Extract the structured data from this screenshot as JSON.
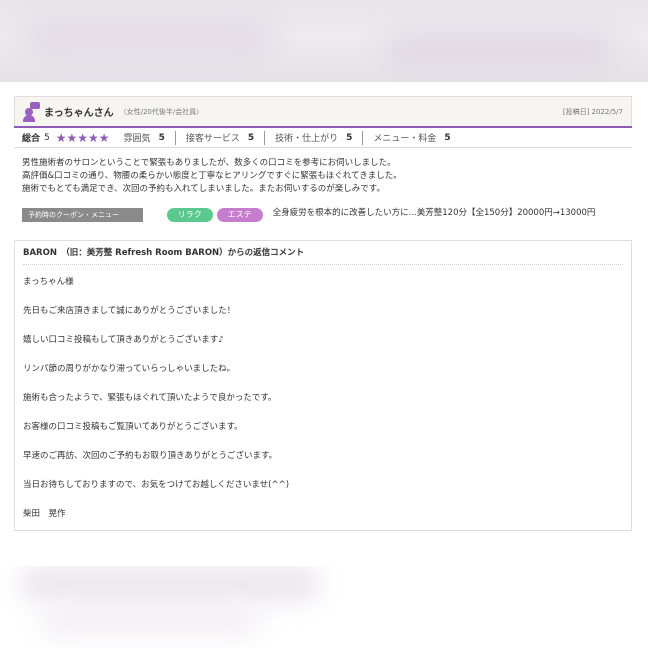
{
  "review": {
    "reviewer_name": "まっちゃんさん",
    "reviewer_attr": "（女性/20代後半/会社員）",
    "posted_date": "[投稿日] 2022/5/7",
    "overall_label": "総合",
    "overall_value": "5",
    "stars": "★★★★★",
    "star_color": "#8e5bb5",
    "sub_ratings": [
      {
        "label": "雰囲気",
        "value": "5"
      },
      {
        "label": "接客サービス",
        "value": "5"
      },
      {
        "label": "技術・仕上がり",
        "value": "5"
      },
      {
        "label": "メニュー・料金",
        "value": "5"
      }
    ],
    "body_lines": [
      "男性施術者のサロンということで緊張もありましたが、数多くの口コミを参考にお伺いしました。",
      "高評価&口コミの通り、物腰の柔らかい態度と丁寧なヒアリングですぐに緊張もほぐれてきました。",
      "施術でもとても満足でき、次回の予約も入れてしまいました。またお伺いするのが楽しみです。"
    ],
    "coupon_label": "予約時のクーポン・メニュー",
    "tags": [
      "リラク",
      "エステ"
    ],
    "tag_colors": {
      "relax": "#5bc98d",
      "esthe": "#c77dce"
    },
    "coupon_text": "全身疲労を根本的に改善したい方に...美芳整120分【全150分】20000円→13000円"
  },
  "reply": {
    "title": "BARON　（旧：美芳整 Refresh Room BARON）からの返信コメント",
    "lines": [
      "まっちゃん様",
      "先日もご来店頂きまして誠にありがとうございました！",
      "嬉しい口コミ投稿もして頂きありがとうございます♪",
      "リンパ節の周りがかなり滞っていらっしゃいましたね。",
      "施術も合ったようで、緊張もほぐれて頂いたようで良かったです。",
      "お客様の口コミ投稿もご覧頂いてありがとうございます。",
      "早速のご再訪、次回のご予約もお取り頂きありがとうございます。",
      "当日お待ちしておりますので、お気をつけてお越しくださいませ(^^)",
      "柴田　晃作"
    ]
  }
}
